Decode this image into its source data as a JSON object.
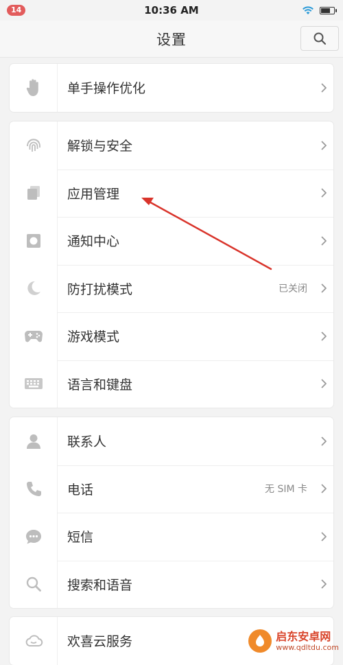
{
  "status_bar": {
    "notification_count": "14",
    "time": "10:36 AM",
    "battery_level": 0.75
  },
  "header": {
    "title": "设置",
    "search_icon": "search-icon"
  },
  "groups": [
    {
      "items": [
        {
          "label": "单手操作优化",
          "icon": "hand-icon",
          "value": ""
        }
      ]
    },
    {
      "items": [
        {
          "label": "解锁与安全",
          "icon": "fingerprint-icon",
          "value": ""
        },
        {
          "label": "应用管理",
          "icon": "app-stack-icon",
          "value": ""
        },
        {
          "label": "通知中心",
          "icon": "notification-square-icon",
          "value": ""
        },
        {
          "label": "防打扰模式",
          "icon": "moon-icon",
          "value": "已关闭"
        },
        {
          "label": "游戏模式",
          "icon": "gamepad-icon",
          "value": ""
        },
        {
          "label": "语言和键盘",
          "icon": "keyboard-icon",
          "value": ""
        }
      ]
    },
    {
      "items": [
        {
          "label": "联系人",
          "icon": "person-icon",
          "value": ""
        },
        {
          "label": "电话",
          "icon": "phone-icon",
          "value": "无 SIM 卡"
        },
        {
          "label": "短信",
          "icon": "message-icon",
          "value": ""
        },
        {
          "label": "搜索和语音",
          "icon": "search-icon",
          "value": ""
        }
      ]
    },
    {
      "items": [
        {
          "label": "欢喜云服务",
          "icon": "cloud-icon",
          "value": ""
        }
      ]
    }
  ],
  "watermark": {
    "name": "启东安卓网",
    "url": "www.qdltdu.com"
  },
  "colors": {
    "annotation_arrow": "#d9342b",
    "icon_gray": "#bdbdbd",
    "chevron_gray": "#9a9a9a"
  }
}
